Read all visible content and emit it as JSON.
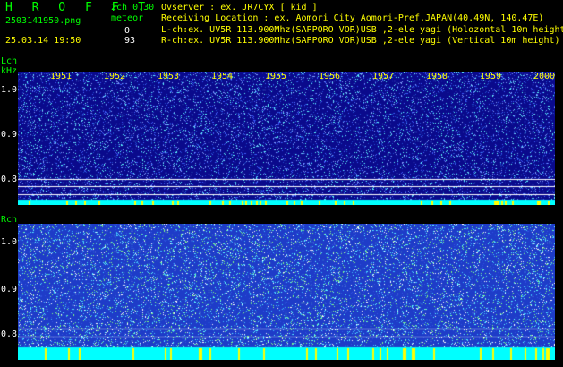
{
  "header": {
    "title": "H R O F F T",
    "version": "2ch 0.30",
    "filename": "2503141950.png",
    "meteor_label": "meteor",
    "lch_count": "0",
    "rch_count": "93",
    "datetime": "25.03.14 19:50",
    "observer": "Ovserver              : ex. JR7CYX [ kid ]",
    "location": "Receiving Location : ex. Aomori City Aomori-Pref.JAPAN(40.49N, 140.47E)",
    "lch_info": "L-ch:ex. UV5R 113.900Mhz(SAPPORO VOR)USB ,2-ele yagi (Holozontal 10m height)",
    "rch_info": "R-ch:ex. UV5R 113.900Mhz(SAPPORO VOR)USB ,2-ele yagi (Vertical 10m height)"
  },
  "left_channel": {
    "label": "Lch",
    "unit": "kHz",
    "y_ticks": [
      "1.0",
      "0.9",
      "0.8"
    ]
  },
  "right_channel": {
    "label": "Rch",
    "y_ticks": [
      "1.0",
      "0.9",
      "0.8"
    ]
  },
  "time_axis": {
    "labels": [
      "1951",
      "1952",
      "1953",
      "1954",
      "1955",
      "1956",
      "1957",
      "1958",
      "1959",
      "2000"
    ]
  },
  "colors": {
    "label_green": "#00ff00",
    "info_yellow": "#ffff00",
    "noise_cyan": "#00ffff",
    "bg_blue_left": "#0a0a8c",
    "bg_blue_right": "#1e3cc8"
  }
}
